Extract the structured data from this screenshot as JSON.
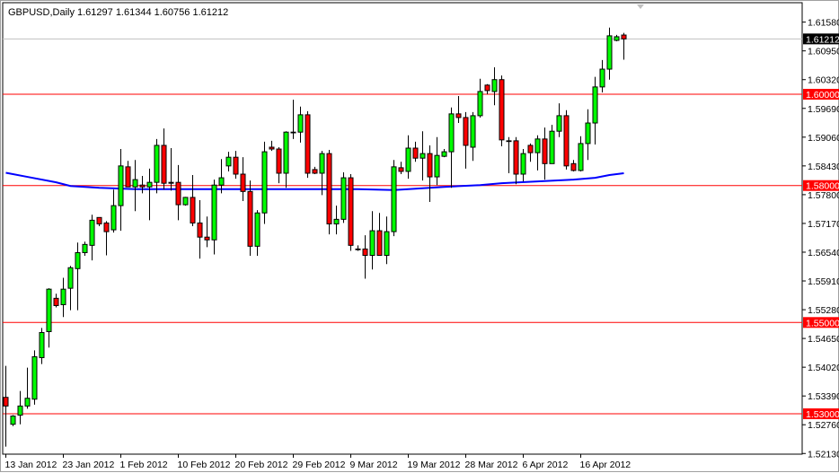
{
  "header": {
    "symbol_timeframe": "GBPUSD,Daily",
    "ohlc": "1.61297 1.61344 1.60756 1.61212"
  },
  "colors": {
    "bull": "#00ff00",
    "bear": "#ff0000",
    "outline": "#000000",
    "level_line": "#ff0000",
    "moving_average": "#0000ff",
    "price_line": "#c0c0c0"
  },
  "chart_data": {
    "type": "candlestick",
    "title": "GBPUSD,Daily",
    "xlabel": "",
    "ylabel": "",
    "ylim": [
      1.52,
      1.619
    ],
    "grid": false,
    "y_ticks": [
      "1.61580",
      "1.60950",
      "1.60320",
      "1.59690",
      "1.59060",
      "1.58430",
      "1.57800",
      "1.57170",
      "1.56540",
      "1.55910",
      "1.55280",
      "1.54650",
      "1.54020",
      "1.53390",
      "1.52760",
      "1.52130"
    ],
    "x_labels": [
      {
        "index": 0,
        "label": "13 Jan 2012"
      },
      {
        "index": 8,
        "label": "23 Jan 2012"
      },
      {
        "index": 16,
        "label": "1 Feb 2012"
      },
      {
        "index": 24,
        "label": "10 Feb 2012"
      },
      {
        "index": 32,
        "label": "20 Feb 2012"
      },
      {
        "index": 40,
        "label": "29 Feb 2012"
      },
      {
        "index": 48,
        "label": "9 Mar 2012"
      },
      {
        "index": 56,
        "label": "19 Mar 2012"
      },
      {
        "index": 64,
        "label": "28 Mar 2012"
      },
      {
        "index": 72,
        "label": "6 Apr 2012"
      },
      {
        "index": 80,
        "label": "16 Apr 2012"
      }
    ],
    "levels": [
      {
        "value": 1.6,
        "label": "1.60000"
      },
      {
        "value": 1.58,
        "label": "1.58000"
      },
      {
        "value": 1.55,
        "label": "1.55000"
      },
      {
        "value": 1.53,
        "label": "1.53000"
      }
    ],
    "current_price": {
      "value": 1.61212,
      "label": "1.61212"
    },
    "candles_ohlc": [
      [
        1.5336,
        1.5405,
        1.5228,
        1.5317
      ],
      [
        1.5277,
        1.5297,
        1.5273,
        1.5295
      ],
      [
        1.5297,
        1.535,
        1.5277,
        1.5317
      ],
      [
        1.5317,
        1.5401,
        1.5311,
        1.5334
      ],
      [
        1.5332,
        1.5439,
        1.532,
        1.5425
      ],
      [
        1.5423,
        1.5488,
        1.5409,
        1.5478
      ],
      [
        1.548,
        1.5575,
        1.5445,
        1.5573
      ],
      [
        1.5553,
        1.5563,
        1.5533,
        1.5537
      ],
      [
        1.5539,
        1.5598,
        1.5512,
        1.5573
      ],
      [
        1.5575,
        1.5624,
        1.5527,
        1.562
      ],
      [
        1.5618,
        1.5675,
        1.5527,
        1.5653
      ],
      [
        1.5653,
        1.5677,
        1.5646,
        1.5671
      ],
      [
        1.5669,
        1.5736,
        1.5636,
        1.5724
      ],
      [
        1.573,
        1.573,
        1.5711,
        1.5716
      ],
      [
        1.5718,
        1.5722,
        1.5647,
        1.5699
      ],
      [
        1.5703,
        1.5791,
        1.5697,
        1.5756
      ],
      [
        1.5756,
        1.588,
        1.5701,
        1.5843
      ],
      [
        1.5841,
        1.5854,
        1.5797,
        1.5797
      ],
      [
        1.5797,
        1.5856,
        1.5744,
        1.5813
      ],
      [
        1.5801,
        1.5821,
        1.5783,
        1.5797
      ],
      [
        1.5797,
        1.5837,
        1.5724,
        1.5807
      ],
      [
        1.5807,
        1.5902,
        1.5783,
        1.5888
      ],
      [
        1.5888,
        1.5925,
        1.5791,
        1.5805
      ],
      [
        1.5807,
        1.5882,
        1.5789,
        1.5805
      ],
      [
        1.5807,
        1.5845,
        1.5724,
        1.5758
      ],
      [
        1.5758,
        1.5775,
        1.5756,
        1.5774
      ],
      [
        1.5774,
        1.5823,
        1.5711,
        1.5718
      ],
      [
        1.5718,
        1.5768,
        1.564,
        1.5687
      ],
      [
        1.5687,
        1.5732,
        1.5665,
        1.5681
      ],
      [
        1.5681,
        1.5813,
        1.5649,
        1.5801
      ],
      [
        1.5801,
        1.5858,
        1.5783,
        1.5817
      ],
      [
        1.5843,
        1.5874,
        1.5831,
        1.5862
      ],
      [
        1.5862,
        1.5876,
        1.5815,
        1.5825
      ],
      [
        1.5825,
        1.5862,
        1.5766,
        1.5787
      ],
      [
        1.5787,
        1.5811,
        1.5646,
        1.5667
      ],
      [
        1.5667,
        1.5746,
        1.5646,
        1.574
      ],
      [
        1.574,
        1.5896,
        1.5716,
        1.5874
      ],
      [
        1.5884,
        1.5898,
        1.5876,
        1.588
      ],
      [
        1.588,
        1.5884,
        1.5805,
        1.5827
      ],
      [
        1.5827,
        1.5919,
        1.5795,
        1.5917
      ],
      [
        1.5917,
        1.5988,
        1.5902,
        1.5916
      ],
      [
        1.5917,
        1.5973,
        1.5894,
        1.5955
      ],
      [
        1.5955,
        1.5963,
        1.5817,
        1.5827
      ],
      [
        1.5835,
        1.5841,
        1.5825,
        1.5827
      ],
      [
        1.5827,
        1.5876,
        1.5779,
        1.587
      ],
      [
        1.587,
        1.5878,
        1.5693,
        1.5716
      ],
      [
        1.5716,
        1.5756,
        1.5693,
        1.5726
      ],
      [
        1.5726,
        1.5829,
        1.5718,
        1.5817
      ],
      [
        1.5817,
        1.5825,
        1.5657,
        1.5669
      ],
      [
        1.5661,
        1.5669,
        1.5657,
        1.5661
      ],
      [
        1.5661,
        1.5691,
        1.5596,
        1.5647
      ],
      [
        1.5647,
        1.5744,
        1.5616,
        1.5701
      ],
      [
        1.5701,
        1.574,
        1.5646,
        1.5647
      ],
      [
        1.5647,
        1.5732,
        1.5628,
        1.5699
      ],
      [
        1.5699,
        1.5856,
        1.5689,
        1.5841
      ],
      [
        1.5839,
        1.5852,
        1.5825,
        1.5831
      ],
      [
        1.5831,
        1.591,
        1.5815,
        1.5882
      ],
      [
        1.5882,
        1.5896,
        1.5852,
        1.586
      ],
      [
        1.586,
        1.5919,
        1.5811,
        1.587
      ],
      [
        1.587,
        1.5888,
        1.5764,
        1.5819
      ],
      [
        1.5819,
        1.5906,
        1.5801,
        1.5866
      ],
      [
        1.5864,
        1.588,
        1.5862,
        1.5874
      ],
      [
        1.5874,
        1.5971,
        1.5795,
        1.5957
      ],
      [
        1.5957,
        1.5996,
        1.5937,
        1.5949
      ],
      [
        1.5949,
        1.5961,
        1.5837,
        1.5888
      ],
      [
        1.5884,
        1.5961,
        1.5854,
        1.5953
      ],
      [
        1.5953,
        1.6034,
        1.5949,
        1.6006
      ],
      [
        1.602,
        1.6022,
        1.6,
        1.6008
      ],
      [
        1.6006,
        1.6059,
        1.5976,
        1.6032
      ],
      [
        1.6032,
        1.6041,
        1.5886,
        1.59
      ],
      [
        1.5898,
        1.5906,
        1.5827,
        1.5898
      ],
      [
        1.5898,
        1.5906,
        1.5803,
        1.5825
      ],
      [
        1.5825,
        1.588,
        1.5809,
        1.587
      ],
      [
        1.5888,
        1.5892,
        1.5852,
        1.5872
      ],
      [
        1.5872,
        1.591,
        1.5833,
        1.5902
      ],
      [
        1.5902,
        1.5927,
        1.5813,
        1.5848
      ],
      [
        1.5848,
        1.5933,
        1.5848,
        1.5919
      ],
      [
        1.5919,
        1.598,
        1.5906,
        1.5953
      ],
      [
        1.5953,
        1.5965,
        1.5835,
        1.5843
      ],
      [
        1.5848,
        1.5856,
        1.5831,
        1.5833
      ],
      [
        1.5833,
        1.5908,
        1.5831,
        1.5892
      ],
      [
        1.5892,
        1.5967,
        1.5856,
        1.5937
      ],
      [
        1.5937,
        1.6038,
        1.589,
        1.6016
      ],
      [
        1.6016,
        1.6075,
        1.6004,
        1.6055
      ],
      [
        1.6055,
        1.6146,
        1.6032,
        1.6128
      ],
      [
        1.6118,
        1.613,
        1.6116,
        1.6126
      ],
      [
        1.61297,
        1.61344,
        1.60756,
        1.61212
      ]
    ],
    "moving_average": [
      [
        0,
        1.5828
      ],
      [
        3,
        1.5819
      ],
      [
        7,
        1.5807
      ],
      [
        9,
        1.5799
      ],
      [
        13,
        1.5795
      ],
      [
        18,
        1.5792
      ],
      [
        29,
        1.5792
      ],
      [
        49,
        1.5792
      ],
      [
        54,
        1.579
      ],
      [
        59,
        1.5795
      ],
      [
        61,
        1.5797
      ],
      [
        66,
        1.5801
      ],
      [
        69,
        1.5805
      ],
      [
        74,
        1.5809
      ],
      [
        79,
        1.5813
      ],
      [
        82,
        1.5817
      ],
      [
        84,
        1.5823
      ],
      [
        86,
        1.5827
      ]
    ]
  }
}
